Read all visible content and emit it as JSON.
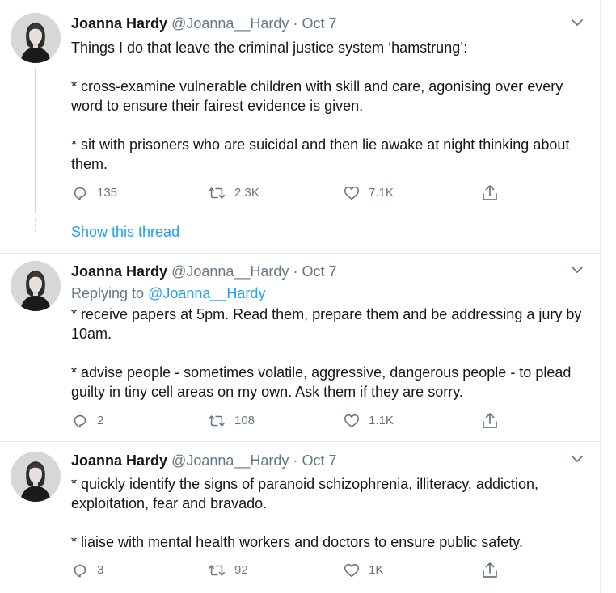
{
  "tweets": [
    {
      "name": "Joanna Hardy",
      "handle": "@Joanna__Hardy",
      "dot": "·",
      "date": "Oct 7",
      "lines": [
        "Things I do that leave the criminal justice system ‘hamstrung’:",
        "",
        "* cross-examine vulnerable children with skill and care, agonising over every word to ensure their fairest evidence is given.",
        "",
        "* sit with prisoners who are suicidal and then lie awake at night thinking about them."
      ],
      "replies": "135",
      "retweets": "2.3K",
      "likes": "7.1K"
    },
    {
      "name": "Joanna Hardy",
      "handle": "@Joanna__Hardy",
      "dot": "·",
      "date": "Oct 7",
      "replying_label": "Replying to",
      "replying_handle": "@Joanna__Hardy",
      "lines": [
        "* receive papers at 5pm. Read them, prepare them and be addressing a jury by 10am.",
        "",
        "* advise people - sometimes volatile, aggressive, dangerous people - to plead guilty in tiny cell areas on my own. Ask them if they are sorry."
      ],
      "replies": "2",
      "retweets": "108",
      "likes": "1.1K"
    },
    {
      "name": "Joanna Hardy",
      "handle": "@Joanna__Hardy",
      "dot": "·",
      "date": "Oct 7",
      "lines": [
        "* quickly identify the signs of paranoid schizophrenia, illiteracy, addiction, exploitation, fear and bravado.",
        "",
        "* liaise with mental health workers and doctors to ensure public safety."
      ],
      "replies": "3",
      "retweets": "92",
      "likes": "1K"
    }
  ],
  "show_thread": "Show this thread",
  "icons": {
    "reply": "reply-icon",
    "retweet": "retweet-icon",
    "like": "like-icon",
    "share": "share-icon",
    "caret": "chevron-down-icon"
  },
  "colors": {
    "link": "#1da1f2",
    "secondary": "#657786",
    "text": "#14171a",
    "border": "#e6ecf0"
  }
}
